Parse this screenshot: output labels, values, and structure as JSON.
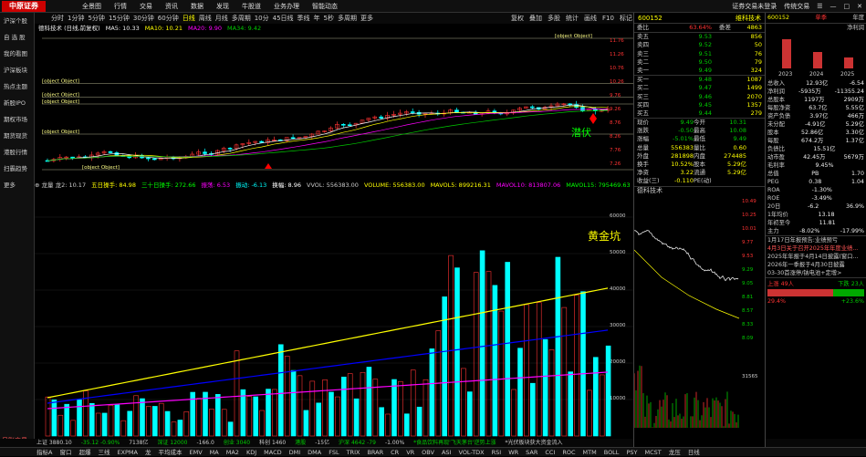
{
  "app": {
    "logo": "中原证券",
    "menu": [
      "全景图",
      "行情",
      "交易",
      "资讯",
      "数据",
      "发现",
      "牛股道",
      "业务办理",
      "智能动态"
    ],
    "topright": [
      "证券交易未登录",
      "传统交易",
      "☰",
      "—",
      "□",
      "✕"
    ]
  },
  "sidebar": [
    "沪深个股",
    "自 选 股",
    "我的看图",
    "沪深板块",
    "热点主题",
    "新股IPO",
    "期权市场",
    "期货现货",
    "港股行情",
    "扫霸趋势",
    "更多"
  ],
  "login": "日账交易",
  "tabs": [
    "分时",
    "1分钟",
    "5分钟",
    "15分钟",
    "30分钟",
    "60分钟",
    "日线",
    "周线",
    "月线",
    "多周期",
    "10分",
    "45日线",
    "季线",
    "年",
    "5秒",
    "多周期",
    "更多"
  ],
  "tabs_active": 6,
  "tabs_right": [
    "复权",
    "叠加",
    "多股",
    "统计",
    "画线",
    "F10",
    "标记",
    "-"
  ],
  "legend": {
    "name": "德科技术 (日线,前复权)",
    "ma5": "MA5: 10.33",
    "ma10": "MA10: 10.21",
    "ma20": "MA20: 9.90",
    "ma34": "MA34: 9.42"
  },
  "levels": [
    {
      "label": "11.81",
      "y": 0.02
    },
    {
      "label": "50.0% 10.22",
      "y": 0.35
    },
    {
      "label": "33.3% 9.69",
      "y": 0.45
    },
    {
      "label": "25.0% 9.43",
      "y": 0.5
    },
    {
      "label": "Base 8.63",
      "y": 0.72
    },
    {
      "label": "7.34",
      "y": 0.98
    }
  ],
  "price_ticks": [
    "11.76",
    "11.26",
    "10.76",
    "10.26",
    "9.76",
    "9.26",
    "8.76",
    "8.26",
    "7.76",
    "7.26"
  ],
  "ann_qianfu": "潜伏",
  "ann_huangjin": "黄金坑",
  "ind": [
    "⊕ 龙量 龙2: 10.17",
    "五日操手: 84.98",
    "三十日操手: 272.66",
    "振荡: 6.53",
    "振动: -6.13",
    "换幅: 8.96",
    "VVOL: 556383.00",
    "VOLUME: 556383.00",
    "MAVOL5: 899216.31",
    "MAVOL10: 813807.06",
    "MAVOL15: 795469.63"
  ],
  "vol_ticks": [
    "60000",
    "50000",
    "40000",
    "30000",
    "20000",
    "10000"
  ],
  "bottabs": [
    "指标A",
    "窗口",
    "超爆",
    "三线",
    "EXPMA",
    "龙",
    "平均成本",
    "EMV",
    "MA",
    "MA2",
    "KDJ",
    "MACD",
    "DMI",
    "DMA",
    "FSL",
    "TRIX",
    "BRAR",
    "CR",
    "VR",
    "OBV",
    "ASI",
    "VOL-TDX",
    "RSI",
    "WR",
    "SAR",
    "CCI",
    "ROC",
    "MTM",
    "BOLL",
    "PSY",
    "MCST",
    "龙压",
    "日线"
  ],
  "ticker": [
    "上证 3880.10",
    "-35.12 -0.90%",
    "7138亿",
    "深证 12000",
    "-166.0",
    "创业 3040",
    "科创 1460",
    "港股",
    "-15亿",
    "沪深 4642 -79",
    "-1.00%",
    "*食品饮料再现'飞天茅台'逆势上涨",
    "*光伏板块获大资金流入"
  ],
  "quote": {
    "code": "600152",
    "name": "维科技术",
    "webi": "委比",
    "webi_val": "63.64%",
    "weicha": "委差",
    "weicha_val": "4863",
    "asks": [
      {
        "l": "卖五",
        "p": "9.53",
        "v": "856"
      },
      {
        "l": "卖四",
        "p": "9.52",
        "v": "50"
      },
      {
        "l": "卖三",
        "p": "9.51",
        "v": "76"
      },
      {
        "l": "卖二",
        "p": "9.50",
        "v": "79"
      },
      {
        "l": "卖一",
        "p": "9.49",
        "v": "324"
      }
    ],
    "bids": [
      {
        "l": "买一",
        "p": "9.48",
        "v": "1087"
      },
      {
        "l": "买二",
        "p": "9.47",
        "v": "1499"
      },
      {
        "l": "买三",
        "p": "9.46",
        "v": "2070"
      },
      {
        "l": "买四",
        "p": "9.45",
        "v": "1357"
      },
      {
        "l": "买五",
        "p": "9.44",
        "v": "279"
      }
    ],
    "stats": [
      [
        "现价",
        "9.49",
        "今开",
        "10.31"
      ],
      [
        "涨跌",
        "-0.50",
        "最高",
        "10.08"
      ],
      [
        "涨幅",
        "-5.01%",
        "最低",
        "9.49"
      ],
      [
        "总量",
        "556383",
        "量比",
        "0.60"
      ],
      [
        "外盘",
        "281898",
        "内盘",
        "274485"
      ],
      [
        "换手",
        "10.52%",
        "股本",
        "5.29亿"
      ],
      [
        "净资",
        "3.22",
        "流通",
        "5.29亿"
      ],
      [
        "收益(三)",
        "-0.110",
        "PE(动)",
        ""
      ]
    ],
    "mini_label": "德科技术",
    "mini_ticks": [
      "10.49",
      "10.25",
      "10.01",
      "9.77",
      "9.53",
      "9.29",
      "9.05",
      "8.81",
      "8.57",
      "8.33",
      "8.09"
    ],
    "vol_label": "31565"
  },
  "right": {
    "code": "600152",
    "tab1": "单季",
    "tab2": "年度",
    "netprofit": "净利润",
    "bars_years": [
      "2023",
      "2024",
      "2025"
    ],
    "fin": [
      [
        "总收入",
        "12.93亿",
        "同比",
        "-6.54"
      ],
      [
        "净利润",
        "-5935万",
        "同比",
        "-11355.24"
      ],
      [
        "总股本",
        "1197万",
        "换股",
        "2909万"
      ],
      [
        "每股净资",
        "63.7亿",
        "",
        "5.55亿"
      ],
      [
        "资产负债",
        "3.97亿",
        "",
        "466万"
      ],
      [
        "未分配",
        "-4.91亿",
        "",
        "5.29亿"
      ],
      [
        "股本",
        "52.86亿",
        "",
        "3.30亿"
      ],
      [
        "每股",
        "674.2万",
        "",
        "1.37亿"
      ],
      [
        "负债比",
        "15.51亿",
        "",
        ""
      ],
      [
        "动市盈",
        "42.45万",
        "",
        "5679万"
      ],
      [
        "毛利率",
        "9.45%",
        "",
        ""
      ],
      [
        "总值",
        "PB",
        "",
        "1.70"
      ],
      [
        "PEG",
        "0.38",
        "PS",
        "1.04"
      ],
      [
        "ROA",
        "-1.30%",
        "",
        ""
      ],
      [
        "ROE",
        "-3.49%",
        "",
        ""
      ],
      [
        "20日",
        "-6.2",
        "",
        "36.9%"
      ],
      [
        "1年均价",
        "13.18",
        "",
        ""
      ],
      [
        "年初至今",
        "11.81",
        "",
        ""
      ],
      [
        "主力",
        "-8.02%",
        "",
        "-17.99%"
      ]
    ],
    "news": [
      "1月17日年报预告:业绩预亏",
      "4月3日关于召开2025年年度业绩...",
      "2025年年报于4月14日披露(窗口...",
      "2026年一季报于4月30日披露",
      "03-30首涨停/钠电池+定增>"
    ],
    "fund": {
      "up": "上涨 49人",
      "down": "下跌 23人",
      "up_pct": "29.4%",
      "down_pct": "+23.6%"
    }
  }
}
